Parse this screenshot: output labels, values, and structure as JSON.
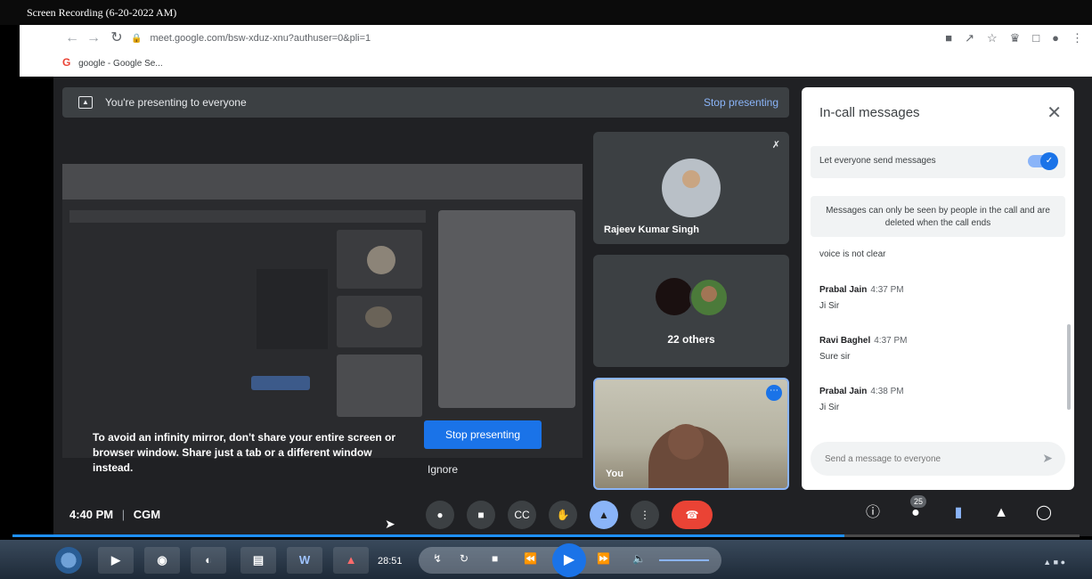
{
  "recording_title": "Screen Recording (6-20-2022 AM)",
  "browser": {
    "url": "meet.google.com/bsw-xduz-xnu?authuser=0&pli=1",
    "bookmark_label": "google - Google Se...",
    "bookmark_letter": "G"
  },
  "presenting_bar": {
    "text": "You're presenting to everyone",
    "stop_label": "Stop presenting"
  },
  "infinity_warning": {
    "text": "To avoid an infinity mirror, don't share your entire screen or browser window. Share just a tab or a different window instead.",
    "stop_button": "Stop presenting",
    "ignore_button": "Ignore"
  },
  "participants": {
    "rajeev": "Rajeev Kumar Singh",
    "others": "22 others",
    "you": "You"
  },
  "chat": {
    "title": "In-call messages",
    "toggle_label": "Let everyone send messages",
    "toggle_on": true,
    "info": "Messages can only be seen by people in the call and are deleted when the call ends",
    "first_message": "voice is not clear",
    "messages": [
      {
        "sender": "Prabal Jain",
        "time": "4:37 PM",
        "body": "Ji Sir"
      },
      {
        "sender": "Ravi Baghel",
        "time": "4:37 PM",
        "body": "Sure sir"
      },
      {
        "sender": "Prabal Jain",
        "time": "4:38 PM",
        "body": "Ji Sir"
      }
    ],
    "input_placeholder": "Send a message to everyone"
  },
  "bottom_bar": {
    "time": "4:40 PM",
    "separator": "|",
    "meeting_code": "CGM",
    "people_count": "25"
  },
  "player": {
    "elapsed": "28:51",
    "progress": 0.78
  },
  "colors": {
    "meet_bg": "#202124",
    "accent": "#1a73e8",
    "end_call": "#ea4335",
    "link": "#8ab4f8"
  }
}
